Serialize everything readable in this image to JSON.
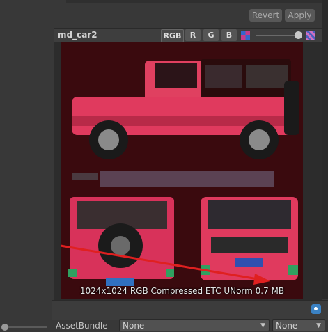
{
  "toolbar": {
    "revert_label": "Revert",
    "apply_label": "Apply"
  },
  "preview": {
    "title": "md_car2",
    "channels": [
      "RGB",
      "R",
      "G",
      "B"
    ],
    "stats": "1024x1024  RGB Compressed ETC UNorm  0.7 MB"
  },
  "assetbundle": {
    "label": "AssetBundle",
    "name_value": "None",
    "variant_value": "None"
  },
  "colors": {
    "texture_bg": "#3a0a0e",
    "car_body": "#d8325a",
    "annotation_arrow": "#e02020"
  }
}
